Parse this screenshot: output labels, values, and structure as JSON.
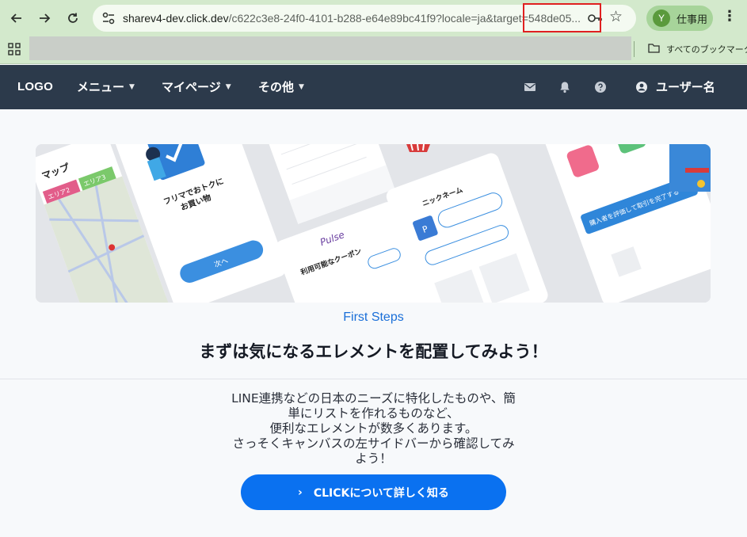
{
  "browser": {
    "url_host": "sharev4-dev.click.dev",
    "url_path": "/c622c3e8-24f0-4101-b288-e64e89bc41f9?locale=ja&target=548de05...",
    "profile_initial": "Y",
    "profile_name": "仕事用",
    "bookmarks_all": "すべてのブックマーク"
  },
  "header": {
    "logo": "LOGO",
    "menus": [
      {
        "label": "メニュー"
      },
      {
        "label": "マイページ"
      },
      {
        "label": "その他"
      }
    ],
    "user_label": "ユーザー名"
  },
  "hero": {
    "phone_texts": {
      "fleamarket": "フリマでおトクに\nお買い物",
      "next_button": "次へ",
      "map_title": "マップ",
      "area2": "エリア2",
      "area3": "エリア3",
      "nickname": "ニックネーム",
      "pulse": "Pulse",
      "coupon": "利用可能なクーポン",
      "purchase": "購入者を評価して取引を完了する"
    }
  },
  "main": {
    "section_label": "First Steps",
    "headline": "まずは気になるエレメントを配置してみよう！",
    "body_lines": [
      "LINE連携などの日本のニーズに特化したものや、簡",
      "単にリストを作れるものなど、",
      "便利なエレメントが数多くあります。",
      "さっそくキャンバスの左サイドバーから確認してみ",
      "よう！"
    ],
    "cta_label": "CLICKについて詳しく知る"
  },
  "colors": {
    "chrome": "#d3e9cc",
    "header_bg": "#2c3a4b",
    "accent": "#0a71f0",
    "section_label": "#1a6fd8"
  }
}
